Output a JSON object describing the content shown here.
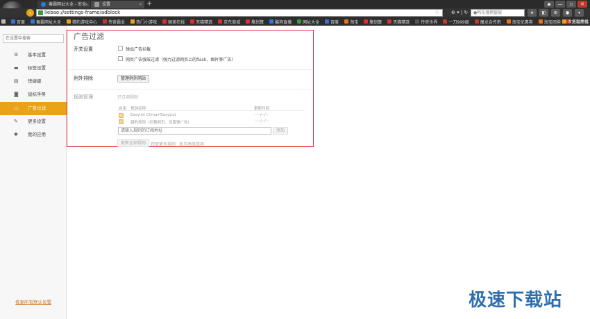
{
  "browser": {
    "tabs": [
      {
        "label": "毒霸网址大全 - 安全..."
      },
      {
        "label": "设置"
      }
    ],
    "new_tab": "+",
    "window_buttons": [
      "▪",
      "—",
      "▫",
      "✕"
    ],
    "address": "liebao://settings-frame/adblock",
    "address_star": "☆",
    "address_tools": "⊕ ▾ | ↻",
    "search_placeholder": "●韩东撞倒窗玻",
    "toolbar_icons": [
      "★",
      "◧",
      "⊞",
      "●",
      "▾"
    ],
    "bookmarks": [
      {
        "label": "百度",
        "color": "#3b6fd6"
      },
      {
        "label": "毒霸网址大全",
        "color": "#2a7bd6"
      },
      {
        "label": "猎豹游戏中心",
        "color": "#e8a317"
      },
      {
        "label": "传奇霸业",
        "color": "#c0392b"
      },
      {
        "label": "热门小游戏",
        "color": "#e8a317"
      },
      {
        "label": "国美在线",
        "color": "#d93030"
      },
      {
        "label": "天猫精选",
        "color": "#d93030"
      },
      {
        "label": "京东商城",
        "color": "#d93030"
      },
      {
        "label": "聚划算",
        "color": "#d93030"
      },
      {
        "label": "酷狗直播",
        "color": "#2a7bd6"
      },
      {
        "label": "网址大全",
        "color": "#3a9a3a"
      },
      {
        "label": "百度",
        "color": "#3b6fd6"
      },
      {
        "label": "淘宝",
        "color": "#e8731a"
      },
      {
        "label": "聚划算",
        "color": "#d93030"
      },
      {
        "label": "天猫精选",
        "color": "#d93030"
      },
      {
        "label": "传奇世界",
        "color": "#555555"
      },
      {
        "label": "一刀999级",
        "color": "#c0392b"
      },
      {
        "label": "屠龙合传奇",
        "color": "#c0392b"
      },
      {
        "label": "淘宝优惠券",
        "color": "#e8731a"
      },
      {
        "label": "淘宝团购",
        "color": "#e8731a"
      },
      {
        "label": "天猫商城",
        "color": "#d93030"
      }
    ],
    "bookmarks_right": "发送到手机"
  },
  "sidebar": {
    "search_placeholder": "在设置中搜索",
    "items": [
      {
        "label": "基本设置",
        "icon": "⚙",
        "active": false
      },
      {
        "label": "标签设置",
        "icon": "▬",
        "active": false
      },
      {
        "label": "快捷键",
        "icon": "▤",
        "active": false
      },
      {
        "label": "鼠标手势",
        "icon": "◙",
        "active": false
      },
      {
        "label": "广告过滤",
        "icon": "▭",
        "active": true
      },
      {
        "label": "更多设置",
        "icon": "✎",
        "active": false
      },
      {
        "label": "我的应用",
        "icon": "✱",
        "active": false
      }
    ],
    "restore_link": "恢复所有默认设置"
  },
  "adblock": {
    "title": "广告过滤",
    "switch_section": "开关设置",
    "option_popup": "弹出广告拦截",
    "option_strong": "网页广告强效过滤（强力过滤网页上的flash、图片等广告）",
    "exceptions_section": "例外排除",
    "manage_exceptions_button": "管理例外网站",
    "rules_section": "规则管理",
    "subscribed_rules": "已订阅规则",
    "table_headers": {
      "enabled": "启用",
      "name": "规则名称",
      "updated": "更新时间"
    },
    "rules": [
      {
        "name": "Easylist China+EasyList",
        "updated": "----/--/--",
        "enabled": true
      },
      {
        "name": "猎豹规则（拦截网页、设置弹广告）",
        "updated": "----/--/--",
        "enabled": true
      }
    ],
    "rule_url_placeholder": "请输入规则的订阅地址",
    "add_button": "添加",
    "update_all_button": "更新全部规则",
    "get_more_link": "获取更多规则",
    "show_advanced_link": "显示高级选项",
    "checkmark": "✓"
  },
  "watermark": "极速下载站"
}
